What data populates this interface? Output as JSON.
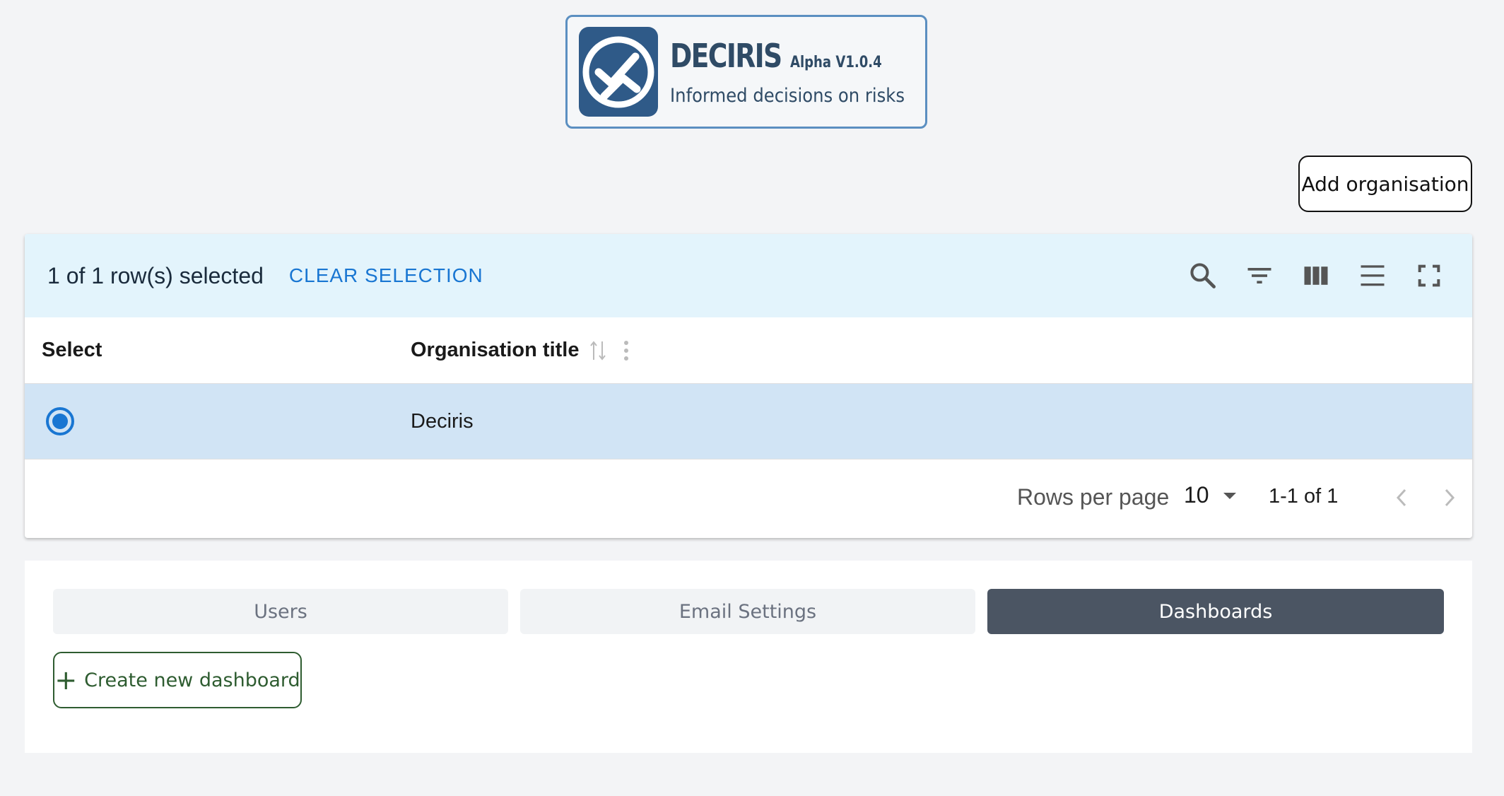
{
  "logo": {
    "title": "DECIRIS",
    "version": "Alpha V1.0.4",
    "tagline": "Informed decisions on risks"
  },
  "actions": {
    "add_organisation": "Add organisation"
  },
  "table": {
    "selection_text": "1 of 1 row(s) selected",
    "clear_selection": "CLEAR SELECTION",
    "toolbar_icons": [
      "search-icon",
      "filter-icon",
      "columns-icon",
      "density-icon",
      "fullscreen-icon"
    ],
    "columns": [
      "Select",
      "Organisation title"
    ],
    "rows": [
      {
        "selected": true,
        "title": "Deciris"
      }
    ],
    "pagination": {
      "rows_per_page_label": "Rows per page",
      "rows_per_page_value": "10",
      "range": "1-1 of 1"
    }
  },
  "tabs": [
    {
      "label": "Users",
      "active": false
    },
    {
      "label": "Email Settings",
      "active": false
    },
    {
      "label": "Dashboards",
      "active": true
    }
  ],
  "dashboards": {
    "create_label": "Create new dashboard"
  },
  "colors": {
    "accent": "#1976d2",
    "toolbar_bg": "#e3f4fc",
    "selected_row_bg": "#d1e4f5",
    "active_tab_bg": "#4b5563",
    "create_btn": "#2e5c30",
    "logo_blue": "#2f5a88"
  }
}
